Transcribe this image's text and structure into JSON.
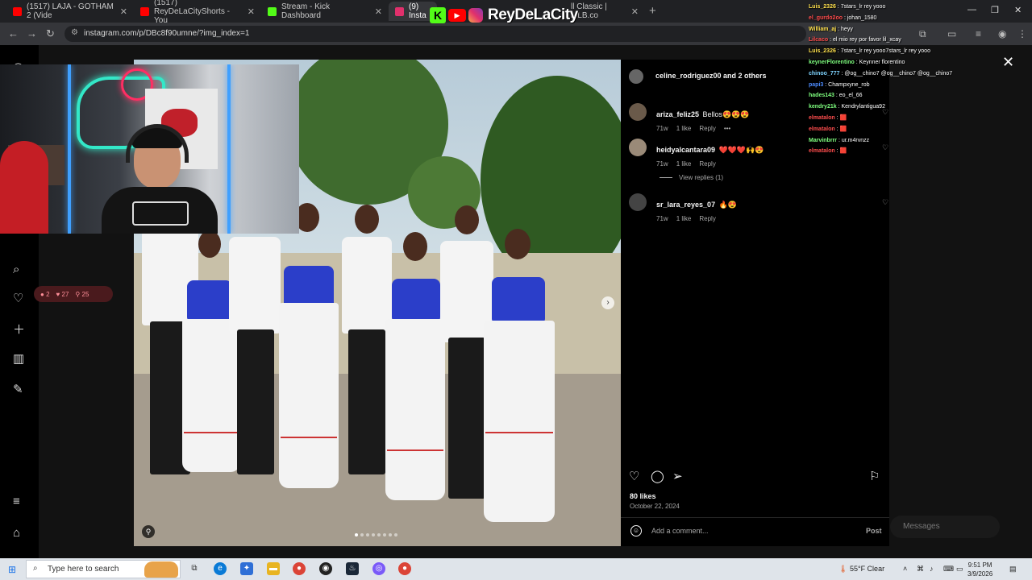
{
  "browser": {
    "tabs": [
      {
        "label": "(1517) LAJA - GOTHAM 2 (Vide",
        "color": "#ff0000"
      },
      {
        "label": "(1517) ReyDeLaCityShorts - You",
        "color": "#ff0000"
      },
      {
        "label": "Stream - Kick Dashboard",
        "color": "#53fc18"
      },
      {
        "label": "(9) Insta",
        "color": "#e1306c"
      },
      {
        "label": "ll Classic | MLB.co",
        "color": "#1f4e99"
      }
    ],
    "url": "instagram.com/p/DBc8f90umne/?img_index=1"
  },
  "stream": {
    "name": "ReyDeLaCity"
  },
  "ig_rail": {
    "notif_comments": "2",
    "notif_likes": "27",
    "notif_follows": "25"
  },
  "post": {
    "liked_by": "celine_rodriguez00 and 2 others",
    "comments": [
      {
        "user": "ariza_feliz25",
        "text": "Bellos😍😍😍",
        "age": "71w",
        "likes": "1 like",
        "reply": "Reply",
        "more": "•••"
      },
      {
        "user": "heidyalcantara09",
        "text": "❤️❤️❤️🙌😍",
        "age": "71w",
        "likes": "1 like",
        "reply": "Reply",
        "view_replies": "View replies (1)"
      },
      {
        "user": "sr_lara_reyes_07",
        "text": "🔥😍",
        "age": "71w",
        "likes": "1 like",
        "reply": "Reply"
      }
    ],
    "likes_count": "80 likes",
    "date": "October 22, 2024",
    "comment_placeholder": "Add a comment...",
    "post_label": "Post"
  },
  "chat": [
    {
      "user": "Luis_2326",
      "msg": "7stars_lr rey yooo",
      "color": "#ffe14d"
    },
    {
      "user": "el_gurdo2oo",
      "msg": "johan_1580",
      "color": "#ff4d4d"
    },
    {
      "user": "William_aj",
      "msg": "heyy",
      "color": "#ffe14d"
    },
    {
      "user": "Lilcaco",
      "msg": "el mio rey por favor lil_xcay",
      "color": "#ff4d4d"
    },
    {
      "user": "Luis_2326",
      "msg": "7stars_lr rey yooo7stars_lr rey yooo",
      "color": "#ffe14d"
    },
    {
      "user": "keynerFlorentino",
      "msg": "Keynner florentino",
      "color": "#7fff7f"
    },
    {
      "user": "chinoo_777",
      "msg": "@og__chino7 @og__chino7 @og__chino7",
      "color": "#7fd4ff"
    },
    {
      "user": "papi3",
      "msg": "Champxyne_rob",
      "color": "#4d8cff"
    },
    {
      "user": "hades143",
      "msg": "eo_el_66",
      "color": "#7fff7f"
    },
    {
      "user": "kendry21k",
      "msg": "Kendrylantigua92",
      "color": "#7fff7f"
    },
    {
      "user": "elmatalon",
      "msg": "🟥",
      "color": "#ff4d4d"
    },
    {
      "user": "elmatalon",
      "msg": "🟥",
      "color": "#ff4d4d"
    },
    {
      "user": "Marvinbrrr",
      "msg": "ur.m4rvnzz",
      "color": "#7fff7f"
    },
    {
      "user": "elmatalon",
      "msg": "🟥",
      "color": "#ff4d4d"
    }
  ],
  "messages_label": "Messages",
  "taskbar": {
    "search_placeholder": "Type here to search",
    "weather": "55°F  Clear",
    "time": "9:51 PM",
    "date": "3/9/2026"
  }
}
